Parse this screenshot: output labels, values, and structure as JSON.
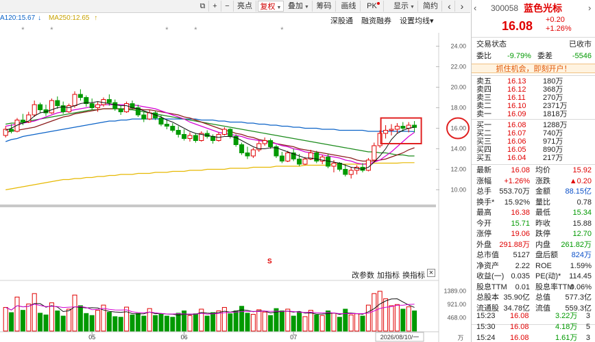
{
  "toolbar": {
    "items": [
      {
        "label": "⧉"
      },
      {
        "label": "+"
      },
      {
        "label": "−"
      },
      {
        "label": "亮点"
      },
      {
        "label": "复权"
      },
      {
        "label": "叠加"
      },
      {
        "label": "筹码"
      },
      {
        "label": "画线"
      },
      {
        "label": "PK"
      },
      {
        "label": "显示"
      },
      {
        "label": "简约"
      }
    ],
    "back_icon": "‹",
    "forward_icon": "›"
  },
  "ma_legend": {
    "ma120": "A120:15.67",
    "ma250": "MA250:12.65",
    "arrow": "↑",
    "down_arrow": "↓",
    "ma120_color": "#0a62c7",
    "ma250_color": "#c8a200"
  },
  "chart_tools": {
    "deep_link": "深股通",
    "margin": "融资融券",
    "ma_setting": "设置均线",
    "ma_setting_arrow": "▾",
    "indicator_params": "改参数",
    "add_indicator": "加指标",
    "switch_indicator": "换指标",
    "close_icon": "×",
    "s_marker": "S"
  },
  "axis": {
    "price_ticks": [
      "24.00",
      "22.00",
      "20.00",
      "18.00",
      "16.00",
      "14.00",
      "12.00",
      "10.00"
    ],
    "volume_ticks": [
      "1389.00",
      "921.00",
      "468.00"
    ],
    "volume_unit": "万",
    "month_labels": [
      "05",
      "06",
      "07"
    ],
    "cursor_date": "2026/08/10/一"
  },
  "chart_data": {
    "type": "candlestick",
    "ylim": [
      9.5,
      24.5
    ],
    "ohlc": [
      [
        15.3,
        16.2,
        15.1,
        15.9
      ],
      [
        15.9,
        16.4,
        15.5,
        15.7
      ],
      [
        15.7,
        17.0,
        15.6,
        16.8
      ],
      [
        16.8,
        17.4,
        16.3,
        16.6
      ],
      [
        16.6,
        17.6,
        16.5,
        17.3
      ],
      [
        17.3,
        18.7,
        17.1,
        18.3
      ],
      [
        18.3,
        18.5,
        17.5,
        17.8
      ],
      [
        17.8,
        18.3,
        17.2,
        17.5
      ],
      [
        17.5,
        18.9,
        17.4,
        18.7
      ],
      [
        18.7,
        19.1,
        17.9,
        18.2
      ],
      [
        18.2,
        18.6,
        17.4,
        17.6
      ],
      [
        17.6,
        18.4,
        17.5,
        18.2
      ],
      [
        18.2,
        19.6,
        18.0,
        19.3
      ],
      [
        19.3,
        19.8,
        18.7,
        19.0
      ],
      [
        19.0,
        19.2,
        18.1,
        18.4
      ],
      [
        18.4,
        18.9,
        17.8,
        18.0
      ],
      [
        18.0,
        18.6,
        17.6,
        18.3
      ],
      [
        18.3,
        19.0,
        18.1,
        18.8
      ],
      [
        18.8,
        19.3,
        18.2,
        18.5
      ],
      [
        18.5,
        18.8,
        17.7,
        17.9
      ],
      [
        17.9,
        18.2,
        17.3,
        17.6
      ],
      [
        17.6,
        18.6,
        17.5,
        18.4
      ],
      [
        18.4,
        18.7,
        17.8,
        18.0
      ],
      [
        18.0,
        18.3,
        17.1,
        17.3
      ],
      [
        17.3,
        17.6,
        16.6,
        16.9
      ],
      [
        16.9,
        17.8,
        16.8,
        17.5
      ],
      [
        17.5,
        17.7,
        16.8,
        17.0
      ],
      [
        17.0,
        17.3,
        16.2,
        16.4
      ],
      [
        16.4,
        16.8,
        15.9,
        16.2
      ],
      [
        16.2,
        16.5,
        15.6,
        15.8
      ],
      [
        15.8,
        16.2,
        15.1,
        15.4
      ],
      [
        15.4,
        15.9,
        14.8,
        15.0
      ],
      [
        15.0,
        15.6,
        14.7,
        15.3
      ],
      [
        15.3,
        15.5,
        14.6,
        14.8
      ],
      [
        14.8,
        15.7,
        14.7,
        15.5
      ],
      [
        15.5,
        15.8,
        15.0,
        15.2
      ],
      [
        15.2,
        15.4,
        14.5,
        14.8
      ],
      [
        14.8,
        15.6,
        14.7,
        15.4
      ],
      [
        15.4,
        16.1,
        15.3,
        15.9
      ],
      [
        15.9,
        16.0,
        15.0,
        15.2
      ],
      [
        15.2,
        15.4,
        14.2,
        14.4
      ],
      [
        14.4,
        14.6,
        13.4,
        13.6
      ],
      [
        13.6,
        14.2,
        13.0,
        13.3
      ],
      [
        13.3,
        14.1,
        13.1,
        13.9
      ],
      [
        13.9,
        14.8,
        13.7,
        14.5
      ],
      [
        14.5,
        15.1,
        14.3,
        14.8
      ],
      [
        14.8,
        15.0,
        14.0,
        14.2
      ],
      [
        14.2,
        14.4,
        13.1,
        13.3
      ],
      [
        13.3,
        13.7,
        12.6,
        12.8
      ],
      [
        12.8,
        13.8,
        12.7,
        13.6
      ],
      [
        13.6,
        14.0,
        12.8,
        13.0
      ],
      [
        13.0,
        13.5,
        12.3,
        12.5
      ],
      [
        12.5,
        13.2,
        12.4,
        13.0
      ],
      [
        13.0,
        13.9,
        12.9,
        13.6
      ],
      [
        13.6,
        13.8,
        12.6,
        12.8
      ],
      [
        12.8,
        13.4,
        12.5,
        13.2
      ],
      [
        13.2,
        13.5,
        12.1,
        12.3
      ],
      [
        12.3,
        12.9,
        11.7,
        12.6
      ],
      [
        12.6,
        12.7,
        11.8,
        12.0
      ],
      [
        12.0,
        12.5,
        11.3,
        11.5
      ],
      [
        11.5,
        12.2,
        11.1,
        11.9
      ],
      [
        11.9,
        12.4,
        11.5,
        12.2
      ],
      [
        12.2,
        12.6,
        11.7,
        11.9
      ],
      [
        11.9,
        13.1,
        11.8,
        12.9
      ],
      [
        12.9,
        14.6,
        12.8,
        14.3
      ],
      [
        14.3,
        15.8,
        14.1,
        15.5
      ],
      [
        15.5,
        16.3,
        15.0,
        15.8
      ],
      [
        15.8,
        16.4,
        15.3,
        15.9
      ],
      [
        15.9,
        16.5,
        15.5,
        16.2
      ],
      [
        16.2,
        16.6,
        15.7,
        16.0
      ],
      [
        16.0,
        16.6,
        15.6,
        16.3
      ],
      [
        16.3,
        16.7,
        15.6,
        16.08
      ]
    ],
    "ma5": [
      15.8,
      16.0,
      16.3,
      16.5,
      16.7,
      17.2,
      17.5,
      17.6,
      17.8,
      18.0,
      18.1,
      18.0,
      18.2,
      18.4,
      18.5,
      18.5,
      18.6,
      18.5,
      18.4,
      18.3,
      18.2,
      18.2,
      18.0,
      17.9,
      17.7,
      17.5,
      17.3,
      17.1,
      16.8,
      16.6,
      16.3,
      16.0,
      15.7,
      15.5,
      15.4,
      15.3,
      15.2,
      15.1,
      15.2,
      15.2,
      15.1,
      14.8,
      14.5,
      14.2,
      14.0,
      14.0,
      14.1,
      14.1,
      13.9,
      13.7,
      13.5,
      13.3,
      13.1,
      13.1,
      13.0,
      12.9,
      12.8,
      12.7,
      12.6,
      12.4,
      12.2,
      12.1,
      12.0,
      12.2,
      12.7,
      13.3,
      14.0,
      14.9,
      15.5,
      15.8,
      16.0,
      16.1
    ],
    "ma10": [
      16.2,
      16.3,
      16.4,
      16.5,
      16.6,
      16.7,
      16.9,
      17.1,
      17.3,
      17.5,
      17.6,
      17.7,
      17.8,
      17.9,
      18.0,
      18.1,
      18.2,
      18.3,
      18.3,
      18.3,
      18.3,
      18.3,
      18.3,
      18.2,
      18.1,
      18.0,
      17.9,
      17.7,
      17.5,
      17.3,
      17.1,
      16.9,
      16.6,
      16.4,
      16.2,
      16.0,
      15.8,
      15.6,
      15.5,
      15.4,
      15.3,
      15.2,
      15.0,
      14.9,
      14.8,
      14.7,
      14.6,
      14.5,
      14.3,
      14.2,
      14.0,
      13.9,
      13.7,
      13.6,
      13.5,
      13.4,
      13.3,
      13.2,
      13.1,
      12.9,
      12.8,
      12.6,
      12.5,
      12.5,
      12.7,
      12.9,
      13.3,
      13.7,
      14.2,
      14.7,
      15.2,
      15.6
    ],
    "ma20": [
      15.6,
      15.7,
      15.8,
      15.9,
      16.0,
      16.1,
      16.3,
      16.5,
      16.7,
      16.9,
      17.1,
      17.2,
      17.4,
      17.5,
      17.6,
      17.7,
      17.8,
      17.9,
      17.9,
      17.9,
      17.9,
      17.9,
      17.9,
      17.9,
      17.8,
      17.8,
      17.7,
      17.6,
      17.5,
      17.4,
      17.3,
      17.1,
      17.0,
      16.8,
      16.6,
      16.4,
      16.2,
      16.0,
      15.8,
      15.7,
      15.5,
      15.4,
      15.2,
      15.1,
      14.9,
      14.8,
      14.7,
      14.5,
      14.4,
      14.3,
      14.2,
      14.0,
      13.9,
      13.8,
      13.7,
      13.6,
      13.5,
      13.4,
      13.3,
      13.2,
      13.1,
      12.9,
      12.8,
      12.8,
      12.8,
      12.9,
      13.0,
      13.2,
      13.4,
      13.6,
      13.9,
      14.1
    ],
    "ma60": [
      16.4,
      16.5,
      16.5,
      16.6,
      16.7,
      16.8,
      16.9,
      17.0,
      17.1,
      17.2,
      17.3,
      17.4,
      17.5,
      17.6,
      17.7,
      17.8,
      17.8,
      17.9,
      17.9,
      17.9,
      17.9,
      17.8,
      17.8,
      17.7,
      17.6,
      17.5,
      17.4,
      17.3,
      17.2,
      17.1,
      17.0,
      16.9,
      16.8,
      16.7,
      16.6,
      16.5,
      16.4,
      16.3,
      16.2,
      16.1,
      16.0,
      15.9,
      15.8,
      15.7,
      15.6,
      15.5,
      15.4,
      15.3,
      15.2,
      15.1,
      15.0,
      14.9,
      14.8,
      14.7,
      14.6,
      14.5,
      14.4,
      14.3,
      14.2,
      14.1,
      14.0,
      13.9,
      13.8,
      13.7,
      13.7,
      13.6,
      13.6,
      13.5,
      13.4,
      13.4,
      13.3,
      13.3
    ],
    "ma120": [
      14.7,
      14.9,
      15.0,
      15.2,
      15.3,
      15.4,
      15.5,
      15.6,
      15.7,
      15.8,
      15.9,
      16.0,
      16.1,
      16.2,
      16.3,
      16.4,
      16.5,
      16.6,
      16.7,
      16.7,
      16.8,
      16.8,
      16.9,
      16.9,
      16.9,
      16.9,
      16.9,
      16.9,
      16.9,
      16.9,
      16.9,
      16.9,
      16.9,
      16.9,
      16.8,
      16.8,
      16.8,
      16.7,
      16.7,
      16.6,
      16.6,
      16.6,
      16.5,
      16.5,
      16.4,
      16.4,
      16.3,
      16.3,
      16.2,
      16.2,
      16.1,
      16.1,
      16.0,
      16.0,
      16.0,
      15.9,
      15.9,
      15.9,
      15.8,
      15.8,
      15.8,
      15.8,
      15.8,
      15.7,
      15.7,
      15.7,
      15.7,
      15.7,
      15.7,
      15.7,
      15.7,
      15.67
    ],
    "ma250": [
      10.0,
      10.1,
      10.2,
      10.3,
      10.4,
      10.5,
      10.6,
      10.7,
      10.8,
      10.9,
      11.0,
      11.0,
      11.1,
      11.1,
      11.2,
      11.2,
      11.3,
      11.3,
      11.4,
      11.4,
      11.5,
      11.5,
      11.5,
      11.6,
      11.6,
      11.6,
      11.7,
      11.7,
      11.7,
      11.8,
      11.8,
      11.8,
      11.9,
      11.9,
      11.9,
      12.0,
      12.0,
      12.0,
      12.0,
      12.1,
      12.1,
      12.1,
      12.1,
      12.2,
      12.2,
      12.2,
      12.2,
      12.3,
      12.3,
      12.3,
      12.3,
      12.3,
      12.4,
      12.4,
      12.4,
      12.4,
      12.4,
      12.5,
      12.5,
      12.5,
      12.5,
      12.5,
      12.5,
      12.6,
      12.6,
      12.6,
      12.6,
      12.6,
      12.6,
      12.65,
      12.65,
      12.65
    ],
    "volume": [
      820,
      640,
      1180,
      720,
      940,
      1300,
      620,
      560,
      980,
      700,
      520,
      760,
      1250,
      880,
      610,
      540,
      720,
      900,
      650,
      500,
      480,
      830,
      560,
      610,
      520,
      780,
      540,
      600,
      520,
      480,
      620,
      700,
      540,
      600,
      760,
      520,
      640,
      700,
      820,
      600,
      700,
      860,
      620,
      580,
      740,
      660,
      540,
      780,
      700,
      760,
      520,
      640,
      500,
      720,
      560,
      540,
      700,
      620,
      480,
      760,
      560,
      600,
      520,
      900,
      1300,
      1380,
      1120,
      880,
      920,
      760,
      840,
      700
    ],
    "vol_ylim": [
      0,
      1400
    ],
    "marks": [
      {
        "index": 3,
        "label": "*"
      },
      {
        "index": 8,
        "label": "*"
      },
      {
        "index": 28,
        "label": "*"
      },
      {
        "index": 33,
        "label": "*"
      },
      {
        "index": 48,
        "label": "*"
      }
    ]
  },
  "colors": {
    "up": "#e00000",
    "down": "#009900",
    "ma5": "#111111",
    "ma10": "#d400d4",
    "ma20": "#8b1a1a",
    "ma60": "#1a8a1a",
    "ma120": "#0a62c7",
    "ma250": "#e6b800"
  },
  "quote": {
    "code": "300058",
    "name": "蓝色光标",
    "price": "16.08",
    "change": "+0.20",
    "change_pct": "+1.26%",
    "trade_status_label": "交易状态",
    "trade_status": "已收市",
    "weibi_label": "委比",
    "weibi": "-9.79%",
    "weicha_label": "委差",
    "weicha": "-5546",
    "banner": "抓住机会，即刻开户！"
  },
  "asks": [
    {
      "label": "卖五",
      "price": "16.13",
      "vol": "180万"
    },
    {
      "label": "卖四",
      "price": "16.12",
      "vol": "368万"
    },
    {
      "label": "卖三",
      "price": "16.11",
      "vol": "270万"
    },
    {
      "label": "卖二",
      "price": "16.10",
      "vol": "2371万"
    },
    {
      "label": "卖一",
      "price": "16.09",
      "vol": "1818万"
    }
  ],
  "bids": [
    {
      "label": "买一",
      "price": "16.08",
      "vol": "1288万"
    },
    {
      "label": "买二",
      "price": "16.07",
      "vol": "740万"
    },
    {
      "label": "买三",
      "price": "16.06",
      "vol": "971万"
    },
    {
      "label": "买四",
      "price": "16.05",
      "vol": "890万"
    },
    {
      "label": "买五",
      "price": "16.04",
      "vol": "217万"
    }
  ],
  "stats": [
    {
      "l1": "最新",
      "v1": "16.08",
      "c1": "red",
      "l2": "均价",
      "v2": "15.92",
      "c2": "red"
    },
    {
      "l1": "涨幅",
      "v1": "+1.26%",
      "c1": "red",
      "l2": "涨跌",
      "v2": "▲0.20",
      "c2": "red"
    },
    {
      "l1": "总手",
      "v1": "553.70万",
      "c1": "black",
      "l2": "金额",
      "v2": "88.15亿",
      "c2": "blue"
    },
    {
      "l1": "换手*",
      "v1": "15.92%",
      "c1": "black",
      "l2": "量比",
      "v2": "0.78",
      "c2": "black"
    },
    {
      "l1": "最高",
      "v1": "16.38",
      "c1": "red",
      "l2": "最低",
      "v2": "15.34",
      "c2": "green"
    },
    {
      "l1": "今开",
      "v1": "15.71",
      "c1": "green",
      "l2": "昨收",
      "v2": "15.88",
      "c2": "black"
    },
    {
      "l1": "涨停",
      "v1": "19.06",
      "c1": "red",
      "l2": "跌停",
      "v2": "12.70",
      "c2": "green"
    },
    {
      "l1": "外盘",
      "v1": "291.88万",
      "c1": "red",
      "l2": "内盘",
      "v2": "261.82万",
      "c2": "green"
    },
    {
      "l1": "总市值",
      "v1": "5127",
      "c1": "black",
      "l2": "盘后额",
      "v2": "824万",
      "c2": "blue"
    },
    {
      "l1": "净资产",
      "v1": "2.22",
      "c1": "black",
      "l2": "ROE",
      "v2": "1.59%",
      "c2": "black"
    },
    {
      "l1": "收益(一)",
      "v1": "0.035",
      "c1": "black",
      "l2": "PE(动)*",
      "v2": "114.45",
      "c2": "black"
    },
    {
      "l1": "股息TTM",
      "v1": "0.01",
      "c1": "black",
      "l2": "股息率TTM",
      "v2": "0.06%",
      "c2": "black"
    },
    {
      "l1": "总股本",
      "v1": "35.90亿",
      "c1": "black",
      "l2": "总值",
      "v2": "577.3亿",
      "c2": "black"
    },
    {
      "l1": "流通股",
      "v1": "34.78亿",
      "c1": "black",
      "l2": "流值",
      "v2": "559.3亿",
      "c2": "black"
    }
  ],
  "ticks": [
    {
      "time": "15:23",
      "price": "16.08",
      "vol": "3.22万",
      "n": "3",
      "pc": "red",
      "vc": "green"
    },
    {
      "time": "15:30",
      "price": "16.08",
      "vol": "4.18万",
      "n": "5",
      "pc": "red",
      "vc": "green"
    },
    {
      "time": "15:24",
      "price": "16.08",
      "vol": "1.61万",
      "n": "3",
      "pc": "red",
      "vc": "green"
    }
  ]
}
